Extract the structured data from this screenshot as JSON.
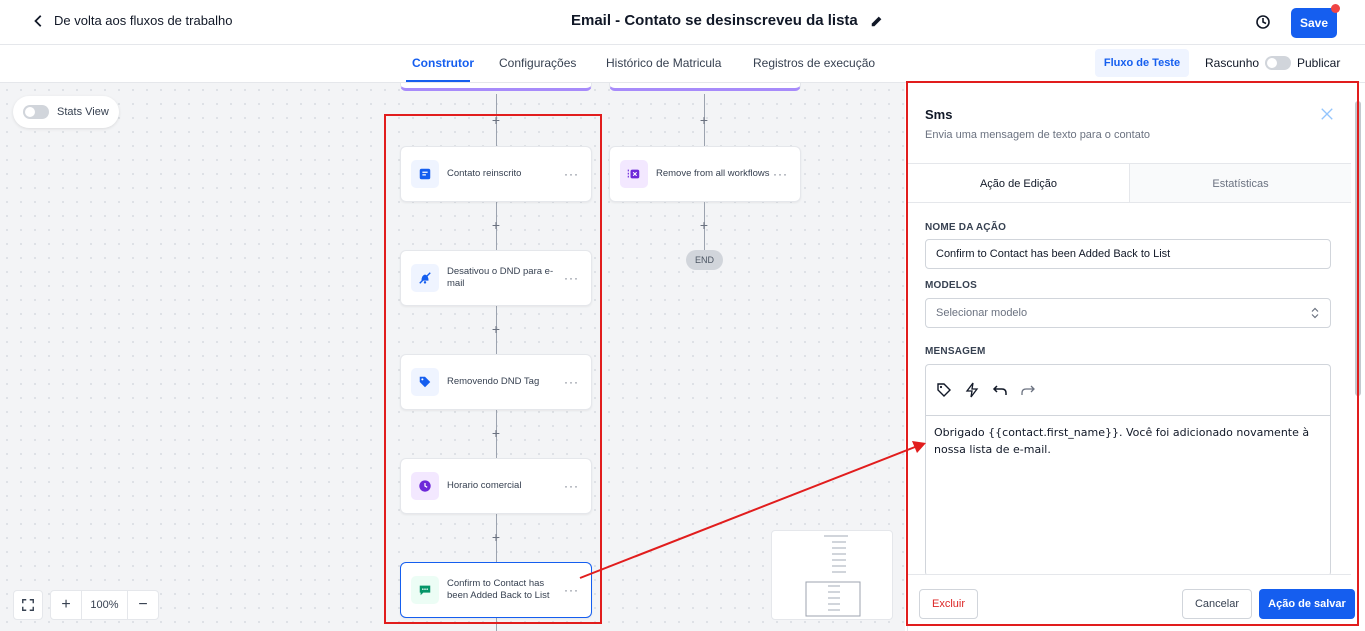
{
  "header": {
    "back_label": "De volta aos fluxos de trabalho",
    "workflow_title": "Email - Contato se desinscreveu da lista",
    "save_label": "Save"
  },
  "tabs": [
    {
      "label": "Construtor",
      "active": true
    },
    {
      "label": "Configurações",
      "active": false
    },
    {
      "label": "Histórico de Matricula",
      "active": false
    },
    {
      "label": "Registros de execução",
      "active": false
    }
  ],
  "toolbar_right": {
    "test_label": "Fluxo de Teste",
    "draft_label": "Rascunho",
    "publish_label": "Publicar"
  },
  "canvas": {
    "stats_view_label": "Stats View",
    "left_branch": [
      {
        "label": "Contato reinscrito",
        "icon": "contact-edit-icon",
        "color": "#155eef"
      },
      {
        "label": "Desativou o DND para e-mail",
        "icon": "bell-off-icon",
        "color": "#155eef"
      },
      {
        "label": "Removendo DND Tag",
        "icon": "tag-remove-icon",
        "color": "#155eef"
      },
      {
        "label": "Horario comercial",
        "icon": "clock-icon",
        "color": "#7c3aed"
      },
      {
        "label": "Confirm to Contact has been Added Back to List",
        "icon": "sms-icon",
        "color": "#059669"
      }
    ],
    "right_branch": [
      {
        "label": "Remove from all workflows",
        "icon": "workflow-remove-icon",
        "color": "#7c3aed"
      }
    ],
    "end_label": "END",
    "zoom_level": "100%"
  },
  "panel": {
    "title": "Sms",
    "subtitle": "Envia uma mensagem de texto para o contato",
    "tabs": [
      "Ação de Edição",
      "Estatísticas"
    ],
    "action_name_label": "NOME DA AÇÃO",
    "action_name_value": "Confirm to Contact has been Added Back to List",
    "templates_label": "MODELOS",
    "templates_placeholder": "Selecionar modelo",
    "message_label": "MENSAGEM",
    "message_text": "Obrigado {{contact.first_name}}. Você foi adicionado novamente à nossa lista de e-mail.",
    "delete_label": "Excluir",
    "cancel_label": "Cancelar",
    "save_action_label": "Ação de salvar"
  },
  "colors": {
    "primary": "#155eef",
    "highlight": "#e11d1d"
  }
}
